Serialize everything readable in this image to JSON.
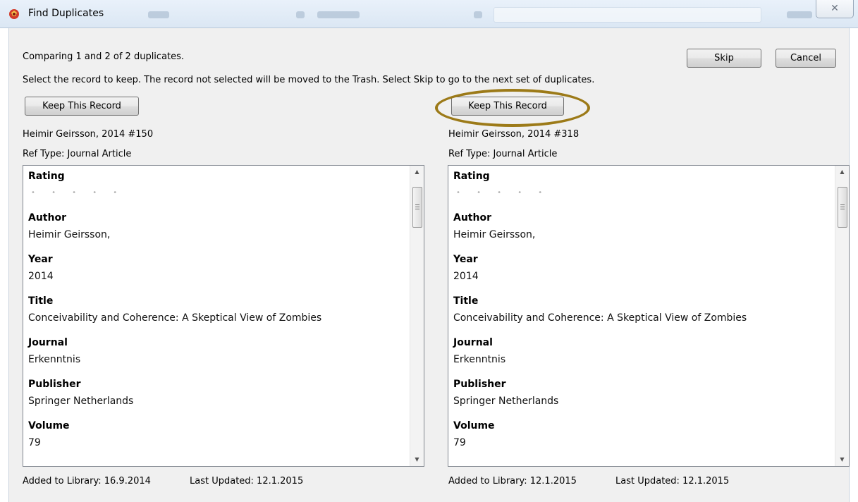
{
  "window": {
    "title": "Find Duplicates",
    "close_glyph": "✕"
  },
  "dialog": {
    "status": "Comparing 1 and 2 of 2 duplicates.",
    "instructions": "Select the record to keep. The record not selected will be moved to the Trash. Select Skip to go to the next set of duplicates.",
    "skip_label": "Skip",
    "cancel_label": "Cancel"
  },
  "records": [
    {
      "keep_label": "Keep This Record",
      "header": "Heimir Geirsson, 2014 #150",
      "ref_type": "Ref Type: Journal Article",
      "rating_label": "Rating",
      "rating_dots": "• • • • •",
      "fields": [
        {
          "label": "Author",
          "value": "Heimir Geirsson,"
        },
        {
          "label": "Year",
          "value": "2014"
        },
        {
          "label": "Title",
          "value": "Conceivability and Coherence: A Skeptical View of Zombies"
        },
        {
          "label": "Journal",
          "value": "Erkenntnis"
        },
        {
          "label": "Publisher",
          "value": "Springer Netherlands"
        },
        {
          "label": "Volume",
          "value": "79"
        }
      ],
      "added": "Added to Library: 16.9.2014",
      "updated": "Last Updated: 12.1.2015"
    },
    {
      "keep_label": "Keep This Record",
      "header": "Heimir Geirsson, 2014 #318",
      "ref_type": "Ref Type: Journal Article",
      "rating_label": "Rating",
      "rating_dots": "• • • • •",
      "fields": [
        {
          "label": "Author",
          "value": "Heimir Geirsson,"
        },
        {
          "label": "Year",
          "value": "2014"
        },
        {
          "label": "Title",
          "value": "Conceivability and Coherence: A Skeptical View of Zombies"
        },
        {
          "label": "Journal",
          "value": "Erkenntnis"
        },
        {
          "label": "Publisher",
          "value": "Springer Netherlands"
        },
        {
          "label": "Volume",
          "value": "79"
        }
      ],
      "added": "Added to Library: 12.1.2015",
      "updated": "Last Updated: 12.1.2015"
    }
  ],
  "colors": {
    "highlight_ring": "#9c7a18",
    "dialog_bg": "#f0f0f0",
    "titlebar": "#dbe7f4"
  }
}
